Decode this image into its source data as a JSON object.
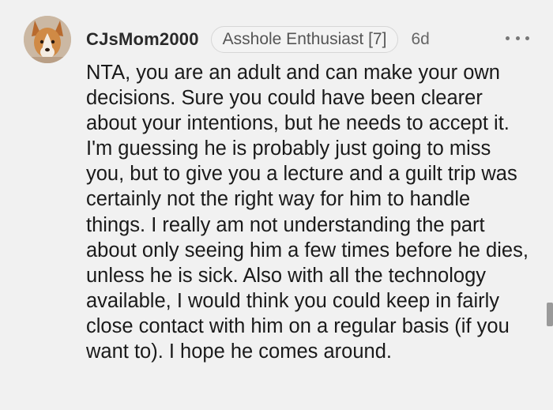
{
  "comment": {
    "username": "CJsMom2000",
    "flair": "Asshole Enthusiast [7]",
    "age": "6d",
    "more_icon": "more-horizontal-icon",
    "body": "NTA, you are an adult and can make your own decisions. Sure you could have been clearer about your intentions, but he needs to accept it. I'm guessing he is probably just going to miss you, but to give you a lecture and a guilt trip was certainly not the right way for him to handle things. I really am not understanding the part about only seeing him a few times before he dies, unless he is sick. Also with all the technology available, I would think you could keep in fairly close contact with him on a regular basis (if you want to). I hope he comes around."
  },
  "colors": {
    "background": "#f1f1f1",
    "text": "#1a1a1a",
    "muted": "#666666"
  }
}
